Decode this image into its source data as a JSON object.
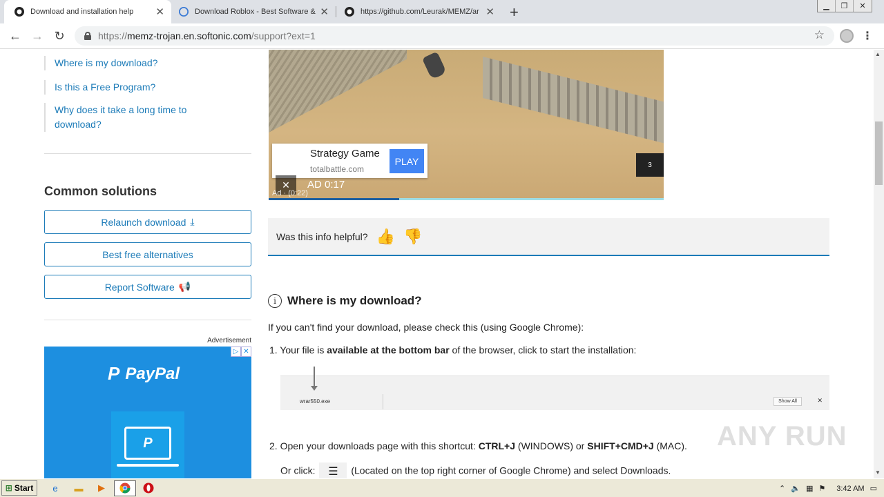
{
  "browser": {
    "tabs": [
      {
        "label": "Download and installation help",
        "icon": "github-icon",
        "active": true
      },
      {
        "label": "Download Roblox - Best Software &",
        "icon": "softonic-icon",
        "active": false
      },
      {
        "label": "https://github.com/Leurak/MEMZ/ar",
        "icon": "github-icon",
        "active": false
      }
    ],
    "url_host": "memz-trojan.en.softonic.com",
    "url_path": "/support?ext=1",
    "url_scheme": "https://"
  },
  "sidebar": {
    "links": [
      "Where is my download?",
      "Is this a Free Program?",
      "Why does it take a long time to download?"
    ],
    "common_solutions_title": "Common solutions",
    "buttons": {
      "relaunch": "Relaunch download",
      "alternatives": "Best free alternatives",
      "report": "Report Software"
    },
    "ad_label": "Advertisement",
    "paypal_logo": "PayPal"
  },
  "video_ad": {
    "title": "Strategy Game",
    "url": "totalbattle.com",
    "play": "PLAY",
    "skip_count": "3",
    "ad_time": "AD  0:17",
    "ad_sub": "Ad · (0:22)",
    "progress": 0.33
  },
  "helpful": {
    "question": "Was this info helpful?"
  },
  "main": {
    "heading": "Where is my download?",
    "intro": "If you can't find your download, please check this (using Google Chrome):",
    "step1_pre": "1. Your file is ",
    "step1_bold": "available at the bottom bar",
    "step1_post": " of the browser, click to start the installation:",
    "dlbar_file": "wrar550.exe",
    "dlbar_showall": "Show All",
    "step2_pre": "2. Open your downloads page with this shortcut: ",
    "step2_b1": "CTRL+J",
    "step2_mid": " (WINDOWS) or ",
    "step2_b2": "SHIFT+CMD+J",
    "step2_post": " (MAC).",
    "step2b_pre": "Or click:",
    "step2b_post": "(Located on the top right corner of Google Chrome) and select Downloads."
  },
  "watermark": "ANY RUN",
  "taskbar": {
    "start": "Start",
    "clock": "3:42 AM"
  }
}
